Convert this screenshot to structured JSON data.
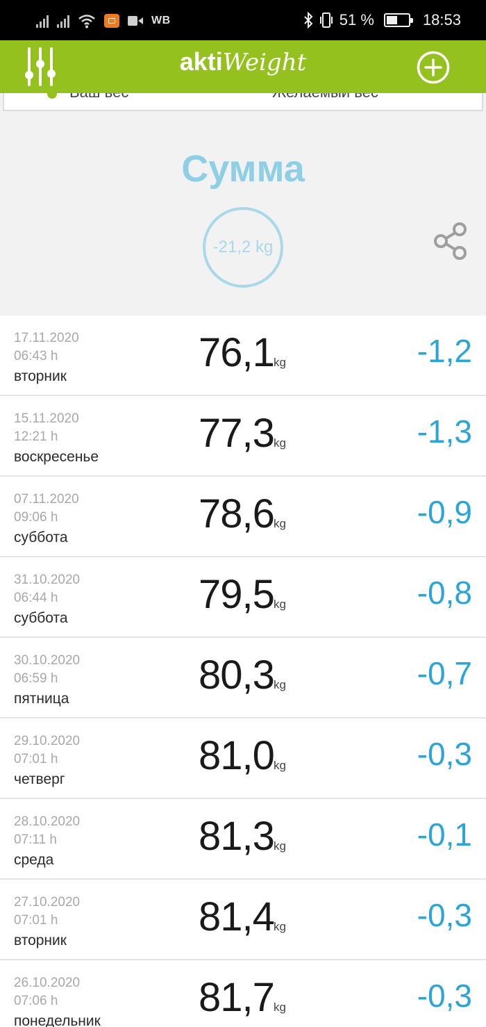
{
  "status_bar": {
    "carrier_label": "WB",
    "battery_percent": "51 %",
    "battery_level": 0.51,
    "time": "18:53",
    "icons": [
      "signal-icon",
      "signal-icon",
      "wifi-icon",
      "app-notification-icon",
      "video-icon",
      "bluetooth-icon",
      "vibrate-icon",
      "battery-icon"
    ]
  },
  "header": {
    "brand_bold": "akti",
    "brand_script": "Weight",
    "brand_color": "#95c11f",
    "menu_icon": "sliders-icon",
    "add_icon": "plus-circle-icon"
  },
  "top_card": {
    "left_text": "Ваш вес",
    "right_text": "Желаемый вес"
  },
  "summary": {
    "title": "Сумма",
    "total": "-21,2 kg",
    "share_icon": "share-icon",
    "accent_color": "#8fcfe6"
  },
  "list": {
    "unit": "kg",
    "diff_color": "#2ba4d8",
    "entries": [
      {
        "date": "17.11.2020",
        "time": "06:43 h",
        "day": "вторник",
        "weight": "76,1",
        "diff": "-1,2"
      },
      {
        "date": "15.11.2020",
        "time": "12:21 h",
        "day": "воскресенье",
        "weight": "77,3",
        "diff": "-1,3"
      },
      {
        "date": "07.11.2020",
        "time": "09:06 h",
        "day": "суббота",
        "weight": "78,6",
        "diff": "-0,9"
      },
      {
        "date": "31.10.2020",
        "time": "06:44 h",
        "day": "суббота",
        "weight": "79,5",
        "diff": "-0,8"
      },
      {
        "date": "30.10.2020",
        "time": "06:59 h",
        "day": "пятница",
        "weight": "80,3",
        "diff": "-0,7"
      },
      {
        "date": "29.10.2020",
        "time": "07:01 h",
        "day": "четверг",
        "weight": "81,0",
        "diff": "-0,3"
      },
      {
        "date": "28.10.2020",
        "time": "07:11 h",
        "day": "среда",
        "weight": "81,3",
        "diff": "-0,1"
      },
      {
        "date": "27.10.2020",
        "time": "07:01 h",
        "day": "вторник",
        "weight": "81,4",
        "diff": "-0,3"
      },
      {
        "date": "26.10.2020",
        "time": "07:06 h",
        "day": "понедельник",
        "weight": "81,7",
        "diff": "-0,3"
      }
    ]
  }
}
